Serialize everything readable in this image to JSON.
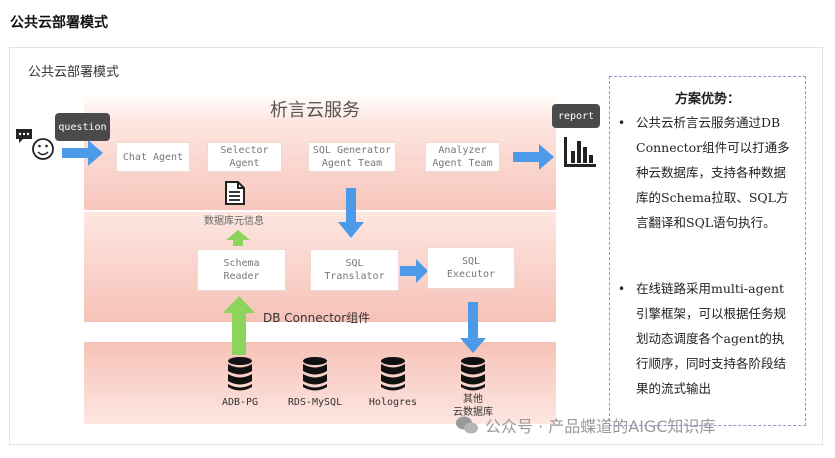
{
  "page": {
    "heading": "公共云部署模式"
  },
  "figure": {
    "title": "公共云部署模式",
    "service_title": "析言云服务",
    "connector_title": "DB Connector组件",
    "question_label": "question",
    "report_label": "report",
    "nodes": {
      "chat_agent": "Chat Agent",
      "selector_agent": "Selector\nAgent",
      "sql_generator": "SQL Generator\nAgent Team",
      "analyzer": "Analyzer\nAgent Team",
      "schema_reader": "Schema\nReader",
      "sql_translator": "SQL\nTranslator",
      "sql_executor": "SQL\nExecutor"
    },
    "metadata_label": "数据库元信息",
    "databases": [
      "ADB-PG",
      "RDS-MySQL",
      "Hologres",
      "其他\n云数据库"
    ]
  },
  "advantages": {
    "title": "方案优势：",
    "items": [
      "公共云析言云服务通过DB Connector组件可以打通多种云数据库，支持各种数据库的Schema拉取、SQL方言翻译和SQL语句执行。",
      "在线链路采用multi-agent引擎框架，可以根据任务规划动态调度各个agent的执行顺序，同时支持各阶段结果的流式输出"
    ]
  },
  "watermark": "公众号 · 产品蝶道的AIGC知识库",
  "colors": {
    "arrow_blue": "#4d9be8",
    "arrow_green": "#8cd45c",
    "band_pink": "#f7c6bc",
    "sidebar_border": "#9a8fd6"
  }
}
